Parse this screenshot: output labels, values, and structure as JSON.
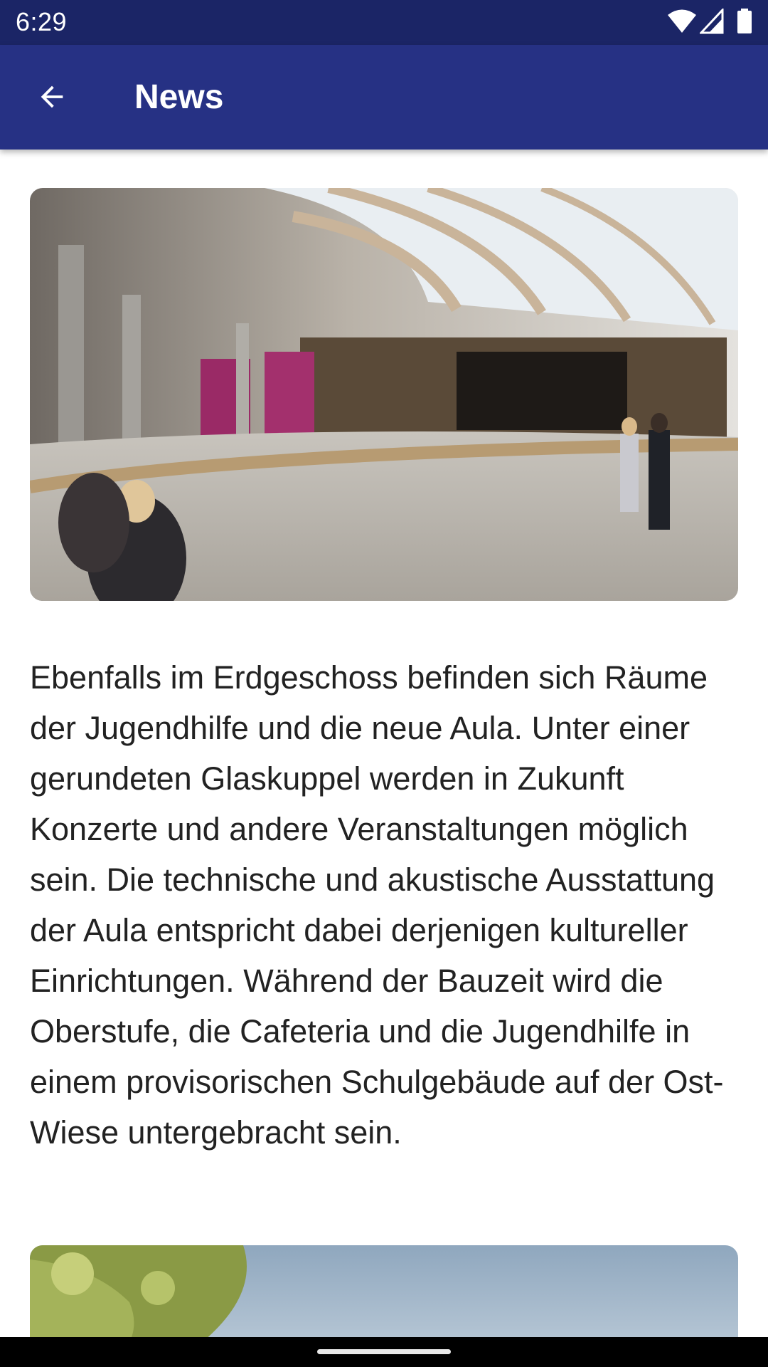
{
  "status_bar": {
    "time": "6:29",
    "icons": [
      "wifi-icon",
      "cell-signal-icon",
      "battery-icon"
    ]
  },
  "app_bar": {
    "title": "News",
    "back_icon": "arrow-back-icon",
    "color": "#263184"
  },
  "article": {
    "hero_image_alt": "auditorium-rendering",
    "text": "Ebenfalls im Erdgeschoss befinden sich Räume der Jugendhilfe und die neue Aula. Unter einer gerundeten Glaskuppel werden in Zukunft Konzerte und andere Veranstaltungen möglich sein. Die technische und akustische Ausstattung der Aula entspricht dabei derjenigen kultureller Einrichtungen. Während der Bauzeit wird die Oberstufe, die Cafeteria und die Jugendhilfe in einem provisorischen Schulgebäude auf der Ost-Wiese untergebracht sein.",
    "second_image_alt": "tree-and-sky-photo"
  },
  "colors": {
    "status_bar": "#1b2566",
    "app_bar": "#263184",
    "text": "#222222"
  }
}
